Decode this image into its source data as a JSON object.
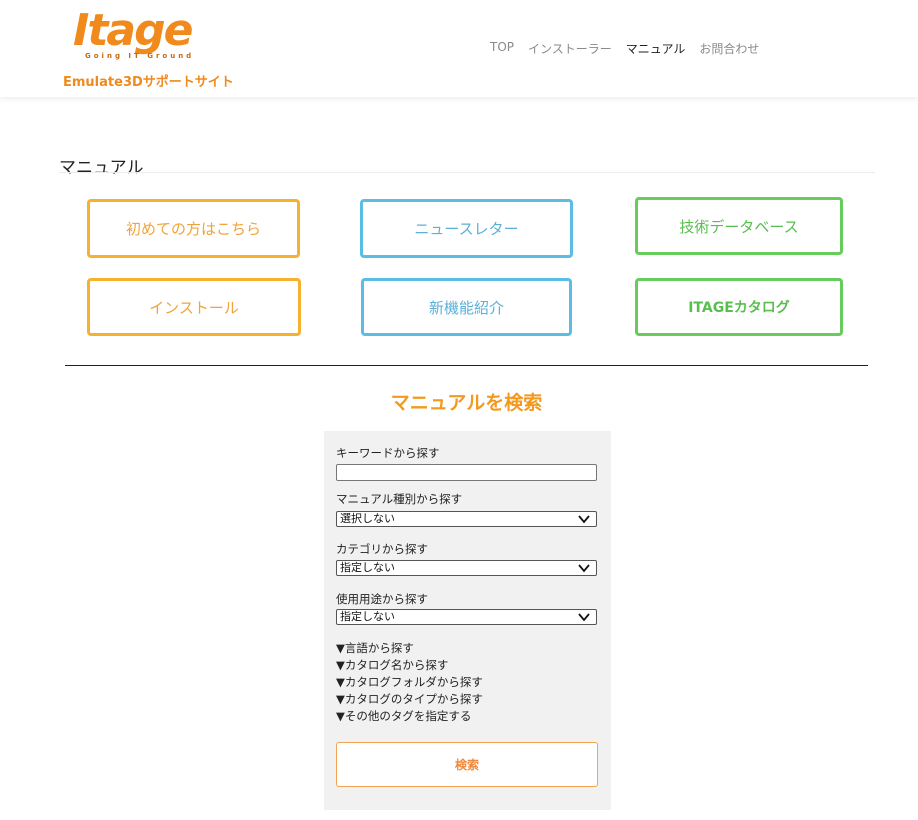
{
  "header": {
    "logo_text": "Itage",
    "logo_tagline": "Going IT Ground",
    "subtitle": "Emulate3Dサポートサイト",
    "nav": [
      "TOP",
      "インストーラー",
      "マニュアル",
      "お問合わせ"
    ],
    "nav_active": "マニュアル"
  },
  "page": {
    "title": "マニュアル"
  },
  "tiles": [
    {
      "label": "初めての方はこちら",
      "color": "#f6b22e"
    },
    {
      "label": "ニュースレター",
      "color": "#5bbde3"
    },
    {
      "label": "技術データベース",
      "color": "#66cc5c"
    },
    {
      "label": "インストール",
      "color": "#f6b22e"
    },
    {
      "label": "新機能紹介",
      "color": "#5bbde3"
    },
    {
      "label": "ITAGEカタログ",
      "color": "#66cc5c"
    }
  ],
  "search": {
    "heading": "マニュアルを検索",
    "keyword_label": "キーワードから探す",
    "keyword_value": "",
    "manual_type_label": "マニュアル種別から探す",
    "manual_type_value": "選択しない",
    "category_label": "カテゴリから探す",
    "category_value": "指定しない",
    "usage_label": "使用用途から探す",
    "usage_value": "指定しない",
    "toggles": [
      "▼言語から探す",
      "▼カタログ名から探す",
      "▼カタログフォルダから探す",
      "▼カタログのタイプから探す",
      "▼その他のタグを指定する"
    ],
    "button_label": "検索"
  },
  "colors": {
    "accent_orange": "#f08a1c",
    "heading_orange": "#f39a1e",
    "panel_bg": "#f1f1f1"
  }
}
